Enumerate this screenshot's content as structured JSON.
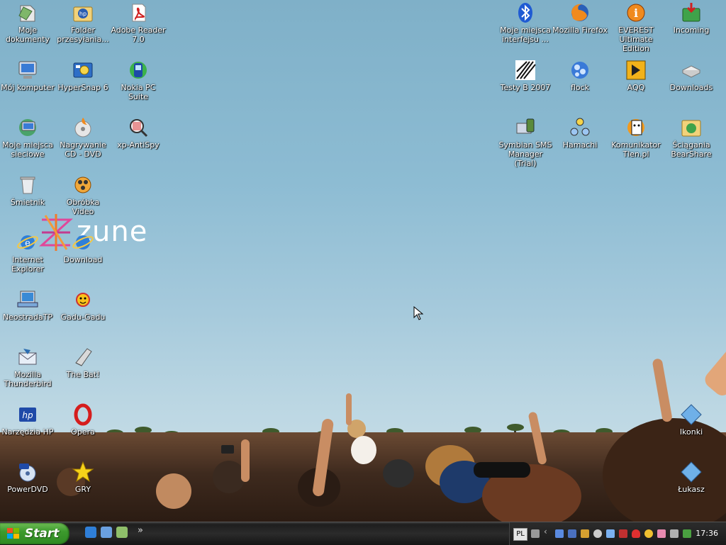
{
  "desktop": {
    "icons": [
      {
        "label": "Moje dokumenty",
        "icon": "my-documents-icon"
      },
      {
        "label": "Folder przesyłania...",
        "icon": "hp-folder-icon"
      },
      {
        "label": "Adobe Reader 7.0",
        "icon": "adobe-reader-icon"
      },
      {
        "label": "Mój komputer",
        "icon": "my-computer-icon"
      },
      {
        "label": "HyperSnap 6",
        "icon": "hypersnap-icon"
      },
      {
        "label": "Nokia PC Suite",
        "icon": "nokia-pc-suite-icon"
      },
      {
        "label": "Moje miejsca sieciowe",
        "icon": "network-places-icon"
      },
      {
        "label": "Nagrywanie CD - DVD",
        "icon": "cd-burning-icon"
      },
      {
        "label": "xp-AntiSpy",
        "icon": "xp-antispy-icon"
      },
      {
        "label": "Śmietnik",
        "icon": "recycle-bin-icon"
      },
      {
        "label": "Obróbka Video",
        "icon": "video-editing-icon"
      },
      {
        "label": "Internet Explorer",
        "icon": "internet-explorer-icon"
      },
      {
        "label": "Download",
        "icon": "download-icon"
      },
      {
        "label": "NeostradaTP",
        "icon": "neostrada-icon"
      },
      {
        "label": "Gadu-Gadu",
        "icon": "gadu-gadu-icon"
      },
      {
        "label": "Mozilla Thunderbird",
        "icon": "thunderbird-icon"
      },
      {
        "label": "The Bat!",
        "icon": "the-bat-icon"
      },
      {
        "label": "Narzędzia HP",
        "icon": "hp-tools-icon"
      },
      {
        "label": "Opera",
        "icon": "opera-icon"
      },
      {
        "label": "PowerDVD",
        "icon": "powerdvd-icon"
      },
      {
        "label": "GRY",
        "icon": "games-star-icon"
      },
      {
        "label": "Moje miejsca interfejsu ...",
        "icon": "bluetooth-icon"
      },
      {
        "label": "Mozilla Firefox",
        "icon": "firefox-icon"
      },
      {
        "label": "EVEREST Ultimate Edition",
        "icon": "everest-icon"
      },
      {
        "label": "Incoming",
        "icon": "incoming-folder-icon"
      },
      {
        "label": "Testy B 2007",
        "icon": "testy-b-icon"
      },
      {
        "label": "flock",
        "icon": "flock-icon"
      },
      {
        "label": "AQQ",
        "icon": "aqq-icon"
      },
      {
        "label": "Downloads",
        "icon": "downloads-drive-icon"
      },
      {
        "label": "Symbian SMS Manager (Trial)",
        "icon": "symbian-sms-icon"
      },
      {
        "label": "Hamachi",
        "icon": "hamachi-icon"
      },
      {
        "label": "Komunikator Tlen.pl",
        "icon": "tlen-icon"
      },
      {
        "label": "Ściągania BearShare",
        "icon": "bearshare-icon"
      },
      {
        "label": "Ikonki",
        "icon": "folder-shortcut-icon"
      },
      {
        "label": "Łukasz",
        "icon": "folder-shortcut-icon"
      }
    ],
    "watermark": "zune"
  },
  "taskbar": {
    "start_label": "Start",
    "quick_launch_more": "»",
    "language": "PL",
    "clock": "17:36"
  },
  "colors": {
    "start_green": "#3c9a2d",
    "taskbar": "#1e1e1e",
    "sky": "#8dbcd3"
  }
}
